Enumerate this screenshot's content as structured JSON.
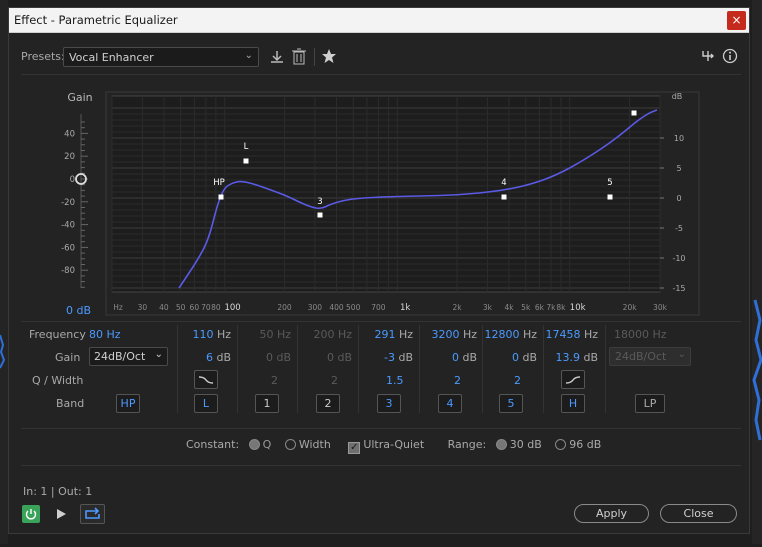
{
  "window": {
    "title": "Effect - Parametric Equalizer",
    "close_label": "×"
  },
  "presets": {
    "label": "Presets:",
    "value": "Vocal Enhancer"
  },
  "graph": {
    "gain_label": "Gain",
    "gain_ticks": [
      "40",
      "20",
      "0",
      "-20",
      "-40",
      "-60",
      "-80"
    ],
    "gain_value": "0 dB",
    "db_label": "dB",
    "db_ticks": [
      "10",
      "5",
      "0",
      "-5",
      "-10",
      "-15"
    ],
    "freq_ticks": [
      "Hz",
      "30",
      "40",
      "50",
      "60",
      "70",
      "80",
      "100",
      "200",
      "300",
      "400",
      "500",
      "700",
      "1k",
      "2k",
      "3k",
      "4k",
      "5k",
      "6k",
      "7k",
      "8k",
      "10k",
      "20k",
      "30k"
    ],
    "band_labels": [
      "HP",
      "L",
      "3",
      "4",
      "5"
    ]
  },
  "bands": {
    "row_labels": {
      "frequency": "Frequency",
      "gain": "Gain",
      "q": "Q / Width",
      "band": "Band"
    },
    "hp": {
      "freq": "80",
      "unit": "Hz",
      "slope": "24dB/Oct",
      "button": "HP"
    },
    "l": {
      "freq": "110",
      "gain": "6",
      "button": "L"
    },
    "b1": {
      "freq": "50",
      "gain": "0",
      "q": "2",
      "button": "1"
    },
    "b2": {
      "freq": "200",
      "gain": "0",
      "q": "2",
      "button": "2"
    },
    "b3": {
      "freq": "291",
      "gain": "-3",
      "q": "1.5",
      "button": "3"
    },
    "b4": {
      "freq": "3200",
      "gain": "0",
      "q": "2",
      "button": "4"
    },
    "b5": {
      "freq": "12800",
      "gain": "0",
      "q": "2",
      "button": "5"
    },
    "h": {
      "freq": "17458",
      "gain": "13.9",
      "button": "H"
    },
    "lp": {
      "freq": "18000",
      "slope": "24dB/Oct",
      "button": "LP"
    },
    "units": {
      "hz": "Hz",
      "db": "dB"
    }
  },
  "options": {
    "constant_label": "Constant:",
    "q_label": "Q",
    "width_label": "Width",
    "ultra_quiet_label": "Ultra-Quiet",
    "range_label": "Range:",
    "range_30": "30 dB",
    "range_96": "96 dB"
  },
  "footer": {
    "io_label": "In: 1 | Out: 1",
    "apply_label": "Apply",
    "close_label": "Close"
  },
  "colors": {
    "accent": "#4a9aff",
    "curve": "#5a5ae6",
    "power_on": "#3aa35a"
  }
}
